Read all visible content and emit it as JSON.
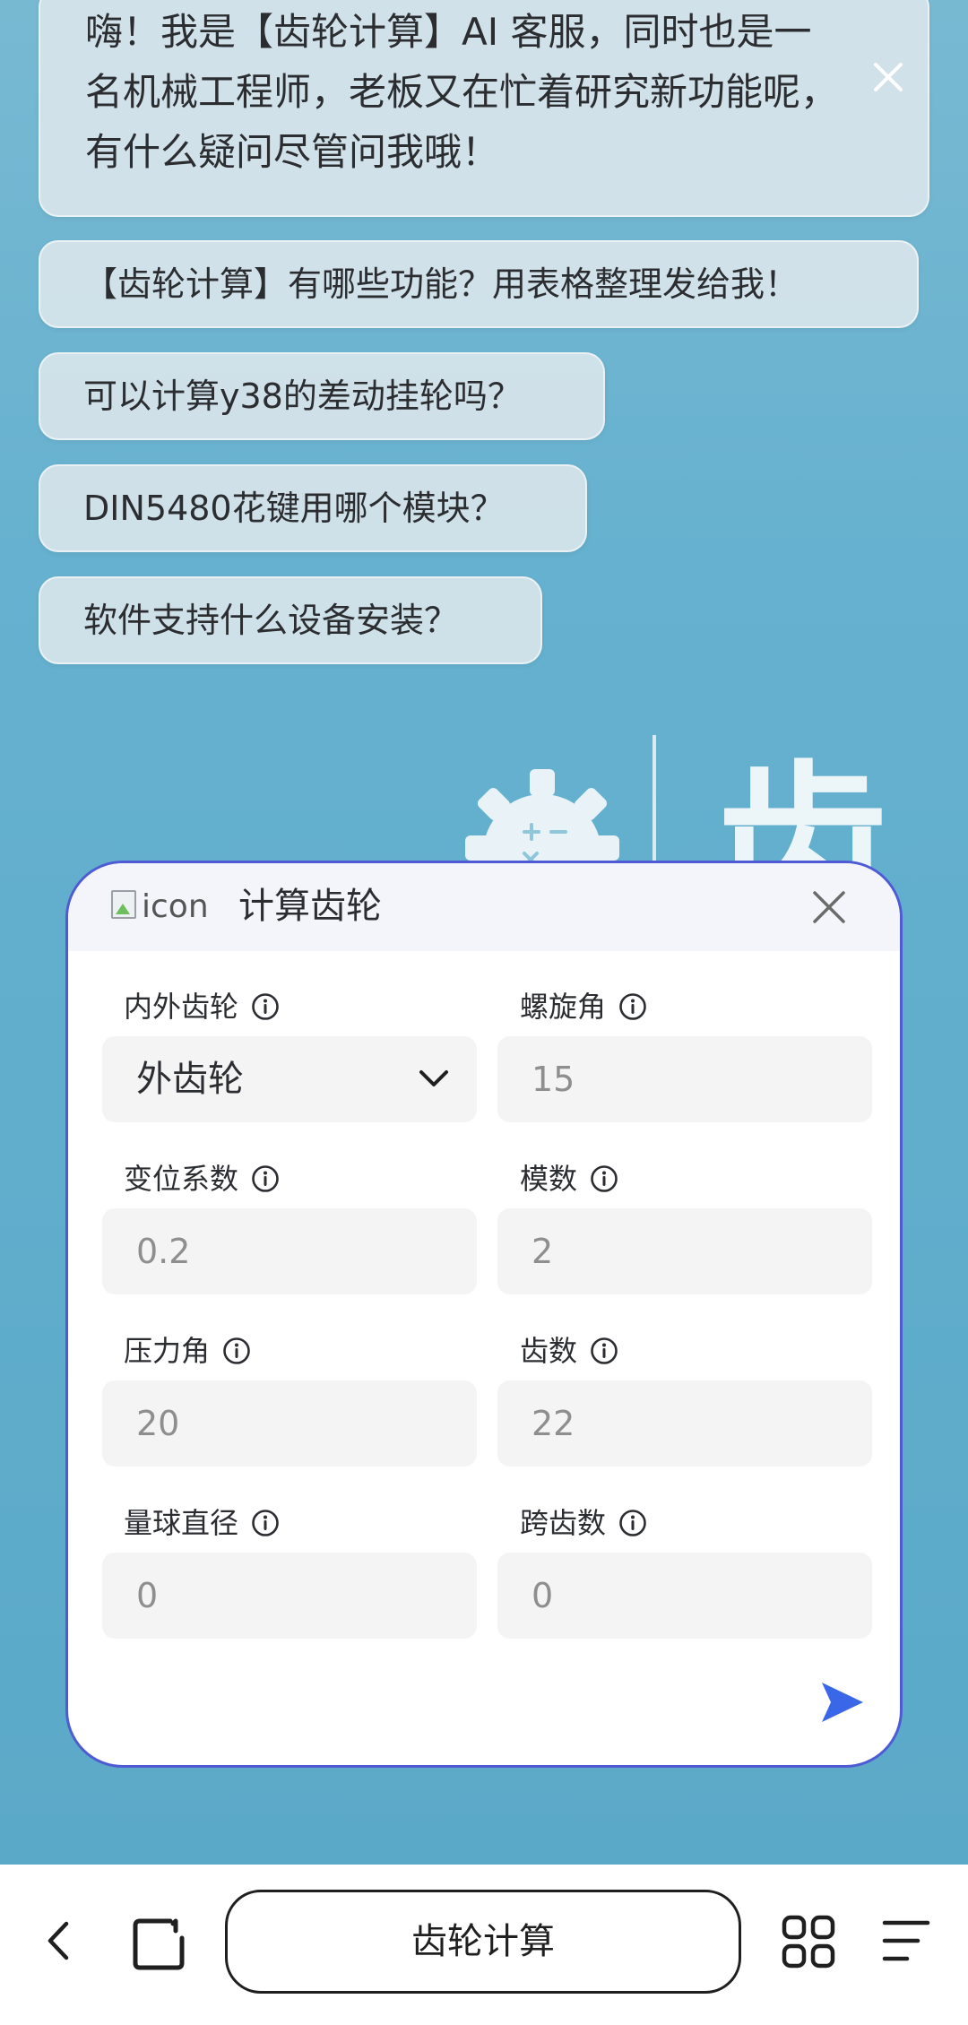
{
  "chat": {
    "greeting": "嗨！我是【齿轮计算】AI 客服，同时也是一名机械工程师，老板又在忙着研究新功能呢，有什么疑问尽管问我哦！",
    "suggestions": [
      "【齿轮计算】有哪些功能？用表格整理发给我！",
      "可以计算y38的差动挂轮吗？",
      "DIN5480花键用哪个模块？",
      "软件支持什么设备安装？"
    ]
  },
  "background_logo": {
    "char": "齿"
  },
  "dialog": {
    "icon_alt": "icon",
    "title": "计算齿轮",
    "fields": {
      "gear_type": {
        "label": "内外齿轮",
        "value": "外齿轮"
      },
      "helix_angle": {
        "label": "螺旋角",
        "placeholder": "15"
      },
      "shift_coeff": {
        "label": "变位系数",
        "placeholder": "0.2"
      },
      "module": {
        "label": "模数",
        "placeholder": "2"
      },
      "pressure_angle": {
        "label": "压力角",
        "placeholder": "20"
      },
      "teeth": {
        "label": "齿数",
        "placeholder": "22"
      },
      "ball_diameter": {
        "label": "量球直径",
        "placeholder": "0"
      },
      "span_teeth": {
        "label": "跨齿数",
        "placeholder": "0"
      }
    },
    "accent_color": "#3a66e8"
  },
  "browser": {
    "page_title": "齿轮计算"
  }
}
